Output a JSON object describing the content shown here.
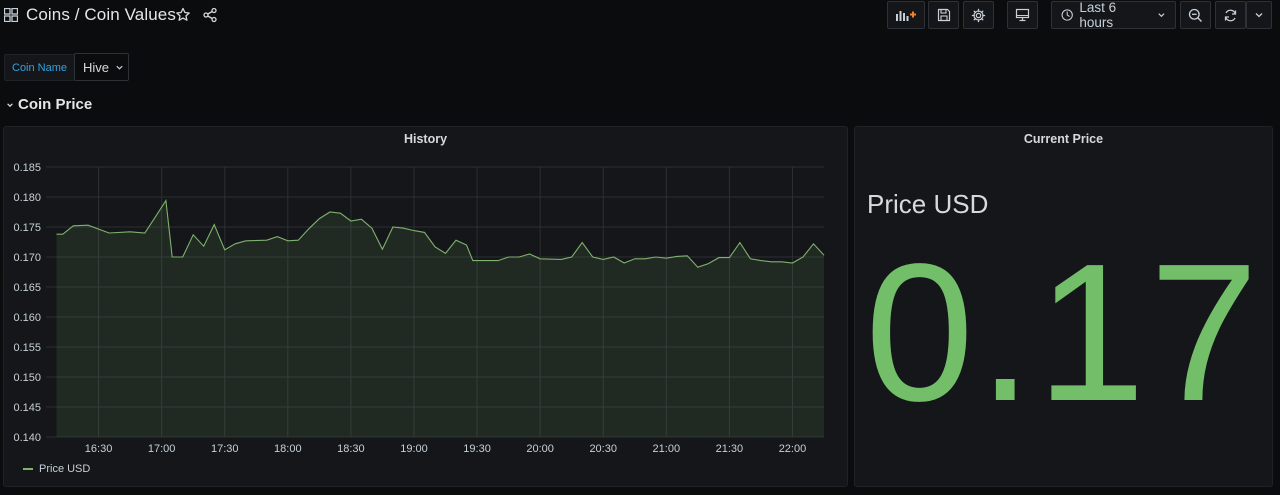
{
  "header": {
    "title": "Coins / Coin Values",
    "time_range_label": "Last 6 hours"
  },
  "variables": {
    "label": "Coin Name",
    "value": "Hive"
  },
  "row": {
    "title": "Coin Price"
  },
  "history_panel": {
    "title": "History",
    "legend": "Price USD"
  },
  "current_panel": {
    "title": "Current Price",
    "label": "Price USD",
    "value": "0.17"
  },
  "colors": {
    "series": "#7eb26d",
    "stat_value": "#73bf69",
    "variable_label": "#33a2e5"
  },
  "chart_data": {
    "type": "line",
    "title": "History",
    "series": [
      {
        "name": "Price USD",
        "x": [
          "16:10",
          "16:13",
          "16:18",
          "16:25",
          "16:35",
          "16:45",
          "16:52",
          "16:58",
          "17:02",
          "17:05",
          "17:10",
          "17:15",
          "17:20",
          "17:25",
          "17:30",
          "17:35",
          "17:40",
          "17:50",
          "17:55",
          "18:00",
          "18:05",
          "18:10",
          "18:15",
          "18:20",
          "18:25",
          "18:30",
          "18:35",
          "18:40",
          "18:45",
          "18:50",
          "18:55",
          "19:00",
          "19:05",
          "19:10",
          "19:15",
          "19:20",
          "19:25",
          "19:28",
          "19:30",
          "19:40",
          "19:45",
          "19:50",
          "19:55",
          "20:00",
          "20:10",
          "20:15",
          "20:20",
          "20:25",
          "20:30",
          "20:35",
          "20:40",
          "20:45",
          "20:50",
          "20:55",
          "21:00",
          "21:05",
          "21:10",
          "21:15",
          "21:20",
          "21:25",
          "21:30",
          "21:35",
          "21:40",
          "21:45",
          "21:50",
          "21:55",
          "22:00",
          "22:05",
          "22:10",
          "22:15"
        ],
        "y": [
          0.1738,
          0.1738,
          0.1752,
          0.1753,
          0.174,
          0.1742,
          0.174,
          0.1772,
          0.1794,
          0.17,
          0.17,
          0.1737,
          0.1718,
          0.1754,
          0.1712,
          0.1722,
          0.1727,
          0.1728,
          0.1734,
          0.1727,
          0.1728,
          0.1747,
          0.1764,
          0.1775,
          0.1773,
          0.176,
          0.1763,
          0.1748,
          0.1713,
          0.175,
          0.1748,
          0.1744,
          0.1741,
          0.1717,
          0.1706,
          0.1728,
          0.172,
          0.1694,
          0.1694,
          0.1694,
          0.17,
          0.17,
          0.1705,
          0.1697,
          0.1696,
          0.17,
          0.1724,
          0.17,
          0.1696,
          0.17,
          0.169,
          0.1697,
          0.1697,
          0.17,
          0.1698,
          0.1701,
          0.1702,
          0.1683,
          0.1689,
          0.1699,
          0.1699,
          0.1724,
          0.1697,
          0.1694,
          0.1692,
          0.1692,
          0.169,
          0.17,
          0.1722,
          0.1703
        ]
      }
    ],
    "x_ticks": [
      "16:30",
      "17:00",
      "17:30",
      "18:00",
      "18:30",
      "19:00",
      "19:30",
      "20:00",
      "20:30",
      "21:00",
      "21:30",
      "22:00"
    ],
    "y_ticks": [
      "0.185",
      "0.180",
      "0.175",
      "0.170",
      "0.165",
      "0.160",
      "0.155",
      "0.150",
      "0.145",
      "0.140"
    ],
    "ylim": [
      0.14,
      0.185
    ],
    "xlim": [
      "16:05",
      "22:15"
    ],
    "grid": true,
    "fill": true,
    "legend_position": "bottom-left"
  }
}
